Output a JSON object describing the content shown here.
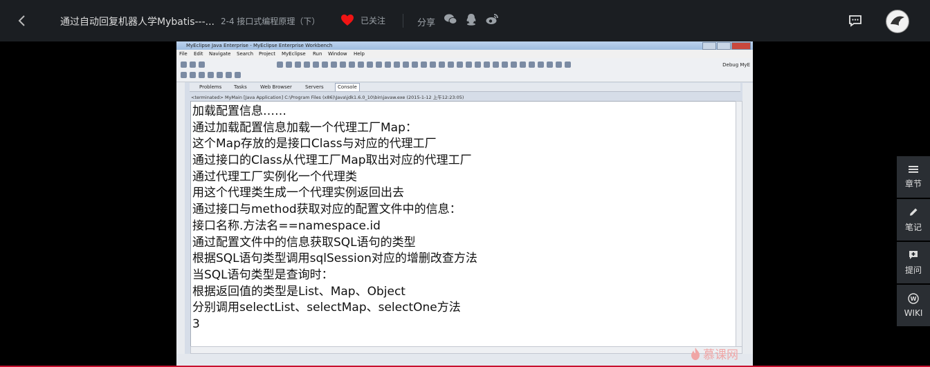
{
  "header": {
    "course_title": "通过自动回复机器人学Mybatis---...",
    "chapter_title": "2-4 接口式编程原理（下）",
    "favorite_label": "已关注",
    "share_label": "分享",
    "share_icons": [
      "wechat-icon",
      "qq-icon",
      "weibo-icon"
    ],
    "accent_color": "#f01414"
  },
  "eclipse": {
    "window_title": "MyEclipse Java Enterprise - MyEclipse Enterprise Workbench",
    "menu": [
      "File",
      "Edit",
      "Navigate",
      "Search",
      "Project",
      "MyEclipse",
      "Run",
      "Window",
      "Help"
    ],
    "perspectives": [
      "Debug",
      "MyE"
    ],
    "view_tabs": [
      "Problems",
      "Tasks",
      "Web Browser",
      "Servers",
      "Console"
    ],
    "active_tab": "Console",
    "terminated_line": "<terminated> MyMain [Java Application] C:\\Program Files (x86)\\Java\\jdk1.6.0_10\\bin\\javaw.exe (2015-1-12 上午12:23:05)",
    "console_lines": [
      "加载配置信息……",
      "通过加载配置信息加载一个代理工厂Map：",
      "这个Map存放的是接口Class与对应的代理工厂",
      "通过接口的Class从代理工厂Map取出对应的代理工厂",
      "通过代理工厂实例化一个代理类",
      "用这个代理类生成一个代理实例返回出去",
      "通过接口与method获取对应的配置文件中的信息：",
      "接口名称.方法名==namespace.id",
      "通过配置文件中的信息获取SQL语句的类型",
      "根据SQL语句类型调用sqlSession对应的增删改查方法",
      "当SQL语句类型是查询时：",
      "根据返回值的类型是List、Map、Object",
      "分别调用selectList、selectMap、selectOne方法",
      "3"
    ]
  },
  "watermark": "慕课网",
  "side_panel": [
    {
      "label": "章节",
      "icon": "menu-icon"
    },
    {
      "label": "笔记",
      "icon": "pencil-icon"
    },
    {
      "label": "提问",
      "icon": "question-icon"
    },
    {
      "label": "WIKI",
      "icon": "wiki-icon"
    }
  ]
}
